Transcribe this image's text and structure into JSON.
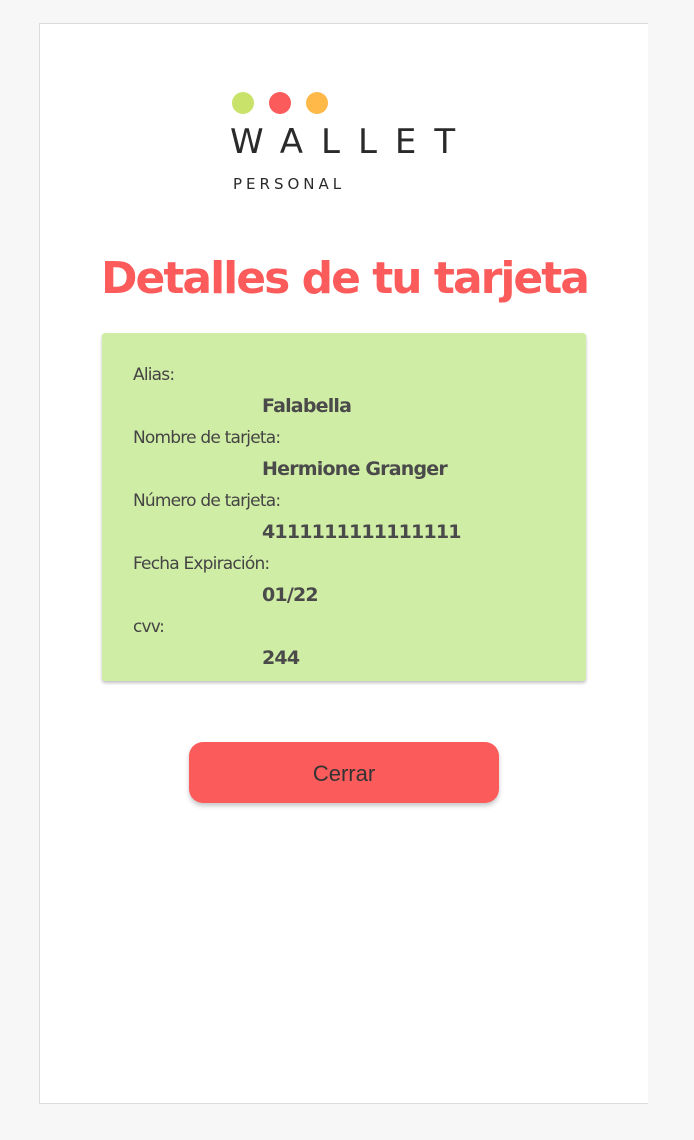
{
  "brand": {
    "name": "WALLET",
    "tagline": "PERSONAL",
    "dot_colors": [
      "#c9e26a",
      "#fb5b5a",
      "#feb949"
    ]
  },
  "page": {
    "title": "Detalles de tu tarjeta"
  },
  "card": {
    "background": "#d0eda6",
    "fields": [
      {
        "label": "Alias:",
        "value": "Falabella"
      },
      {
        "label": "Nombre de tarjeta:",
        "value": "Hermione Granger"
      },
      {
        "label": "Número de tarjeta:",
        "value": "4111111111111111"
      },
      {
        "label": "Fecha Expiración:",
        "value": "01/22"
      },
      {
        "label": "cvv:",
        "value": "244"
      }
    ]
  },
  "actions": {
    "close_label": "Cerrar"
  },
  "colors": {
    "accent": "#fb5b5a"
  }
}
